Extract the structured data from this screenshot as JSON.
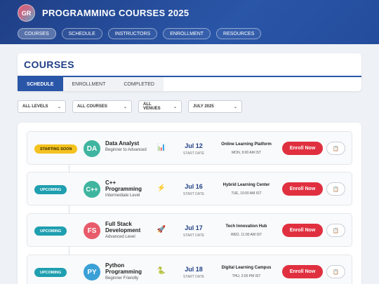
{
  "header": {
    "logo_text": "GR",
    "title": "PROGRAMMING COURSES 2025",
    "nav": [
      "COURSES",
      "SCHEDULE",
      "INSTRUCTORS",
      "ENROLLMENT",
      "RESOURCES"
    ],
    "active_nav": "COURSES"
  },
  "section": {
    "title": "COURSES",
    "tabs": [
      "SCHEDULE",
      "ENROLLMENT",
      "COMPLETED"
    ],
    "active_tab": "SCHEDULE"
  },
  "filters": [
    "ALL LEVELS",
    "ALL COURSES",
    "ALL VENUES",
    "JULY 2025"
  ],
  "courses": [
    {
      "status": "STARTING SOON",
      "initials": "DA",
      "name": "Data Analyst",
      "level": "Beginner to Advanced",
      "icon": "chart-icon",
      "date": "Jul 12",
      "date_label": "START DATE",
      "venue": "Online Learning Platform",
      "time": "MON, 9:00 AM IST",
      "action": "Enroll Now"
    },
    {
      "status": "UPCOMING",
      "initials": "C++",
      "name": "C++ Programming",
      "level": "Intermediate Level",
      "icon": "lightning-icon",
      "date": "Jul 16",
      "date_label": "START DATE",
      "venue": "Hybrid Learning Center",
      "time": "TUE, 10:00 AM IST",
      "action": "Enroll Now"
    },
    {
      "status": "UPCOMING",
      "initials": "FS",
      "name": "Full Stack Development",
      "level": "Advanced Level",
      "icon": "rocket-icon",
      "date": "Jul 17",
      "date_label": "START DATE",
      "venue": "Tech Innovation Hub",
      "time": "WED, 11:00 AM IST",
      "action": "Enroll Now"
    },
    {
      "status": "UPCOMING",
      "initials": "PY",
      "name": "Python Programming",
      "level": "Beginner Friendly",
      "icon": "snake-icon",
      "date": "Jul 18",
      "date_label": "START DATE",
      "venue": "Digital Learning Campus",
      "time": "THU, 2:00 PM IST",
      "action": "Enroll Now"
    }
  ],
  "colors": {
    "brand": "#2a56a8",
    "accent_red": "#e0303f",
    "badge_soon": "#f4c21f",
    "badge_upcoming": "#1f9fb0"
  }
}
